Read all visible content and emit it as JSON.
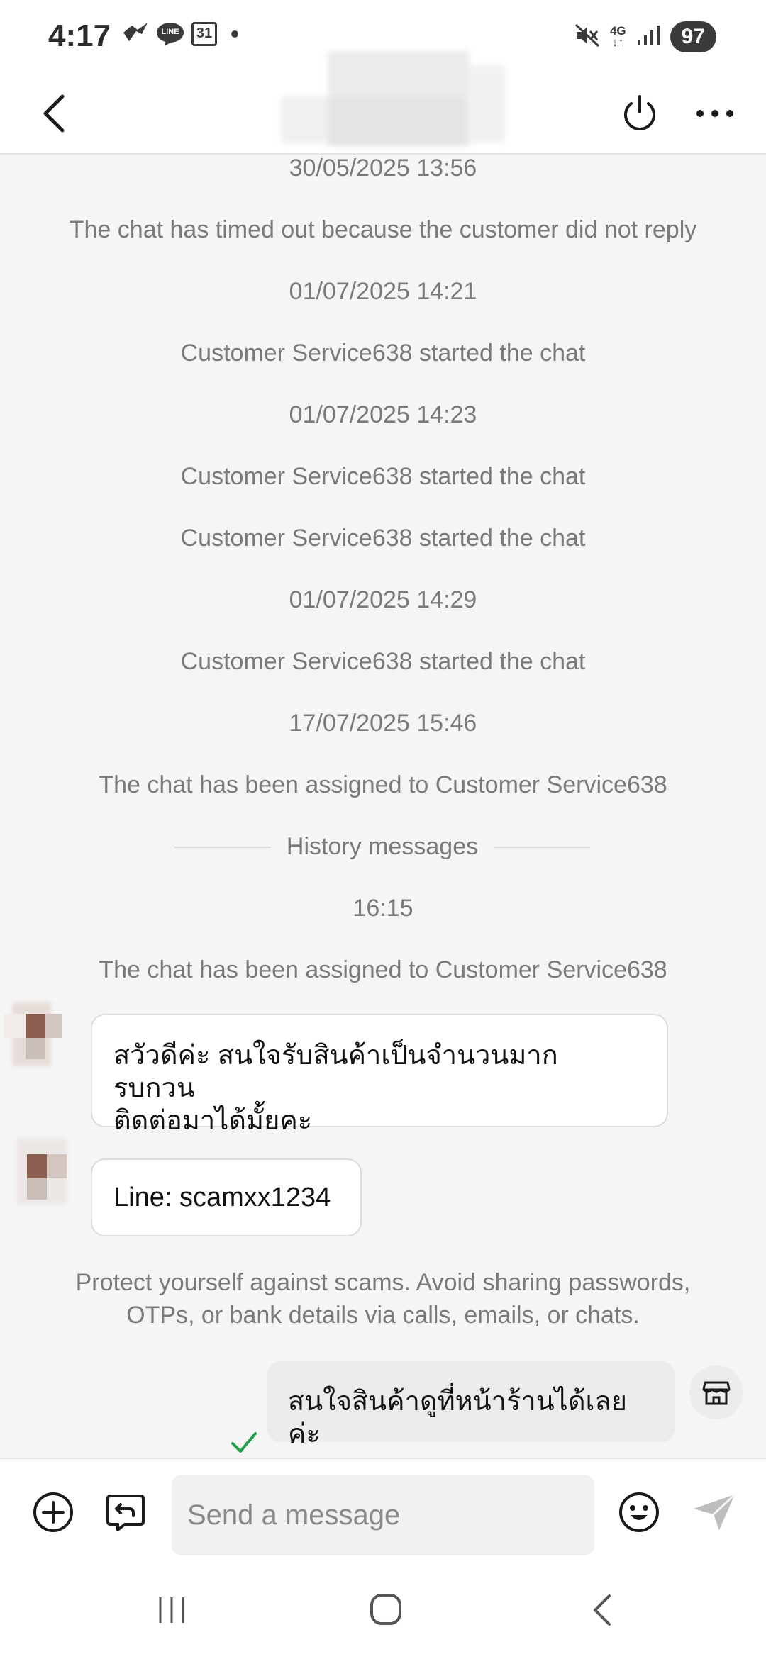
{
  "status_bar": {
    "time": "4:17",
    "left_icons": [
      "tiktok-notification-icon",
      "line-icon",
      "calendar-icon",
      "dot-icon"
    ],
    "calendar_day": "31",
    "line_label": "LINE",
    "right_icons": [
      "mute-icon",
      "4g-icon",
      "signal-icon"
    ],
    "network_label": "4G",
    "battery": "97"
  },
  "header": {
    "title": "",
    "icons": [
      "back-icon",
      "power-icon",
      "more-icon"
    ]
  },
  "chat": {
    "system_lines": [
      "30/05/2025 13:56",
      "The chat has timed out because the customer did not reply",
      "01/07/2025 14:21",
      "Customer Service638 started the chat",
      "01/07/2025 14:23",
      "Customer Service638 started the chat",
      "Customer Service638 started the chat",
      "01/07/2025 14:29",
      "Customer Service638 started the chat",
      "17/07/2025 15:46",
      "The chat has been assigned to Customer Service638"
    ],
    "history_divider": "History messages",
    "time_after_divider": "16:15",
    "assigned_again": "The chat has been assigned to Customer Service638",
    "incoming": [
      {
        "line1": "สวัวดีค่ะ สนใจรับสินค้าเป็นจำนวนมาก รบกวน",
        "line2": "ติดต่อมาได้มั้ยคะ"
      },
      {
        "line1": "Line: scamxx1234"
      }
    ],
    "warning_line1": "Protect yourself against scams. Avoid sharing passwords,",
    "warning_line2": "OTPs, or bank details via calls, emails, or chats.",
    "outgoing": {
      "text": "สนใจสินค้าดูที่หน้าร้านได้เลยค่ะ",
      "status_icon": "check-icon"
    }
  },
  "composer": {
    "placeholder": "Send a message",
    "value": "",
    "icons": [
      "add-icon",
      "quick-reply-icon",
      "emoji-icon",
      "send-icon"
    ]
  },
  "colors": {
    "accent_check": "#22a04a",
    "system_text": "#7a7a7a",
    "background": "#f5f5f5"
  }
}
